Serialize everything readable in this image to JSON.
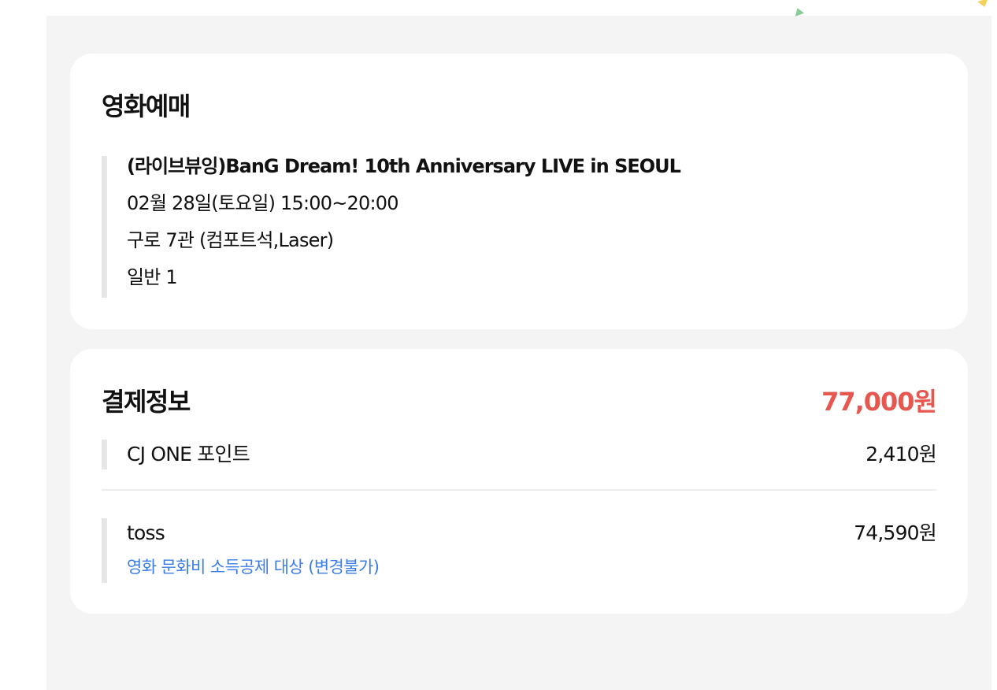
{
  "movie_booking": {
    "title": "영화예매",
    "movie_name": "(라이브뷰잉)BanG Dream! 10th Anniversary LIVE in SEOUL",
    "datetime": "02월 28일(토요일) 15:00~20:00",
    "theater": "구로 7관 (컴포트석,Laser)",
    "tickets": "일반 1"
  },
  "payment": {
    "title": "결제정보",
    "total": "77,000원",
    "methods": [
      {
        "name": "CJ ONE 포인트",
        "amount": "2,410원"
      },
      {
        "name": "toss",
        "amount": "74,590원",
        "note": "영화 문화비 소득공제 대상 (변경불가)"
      }
    ]
  },
  "colors": {
    "background": "#f4f4f4",
    "card": "#ffffff",
    "total_accent": "#e5574f",
    "note_link": "#3a7de8",
    "bar": "#e6e6e6"
  }
}
